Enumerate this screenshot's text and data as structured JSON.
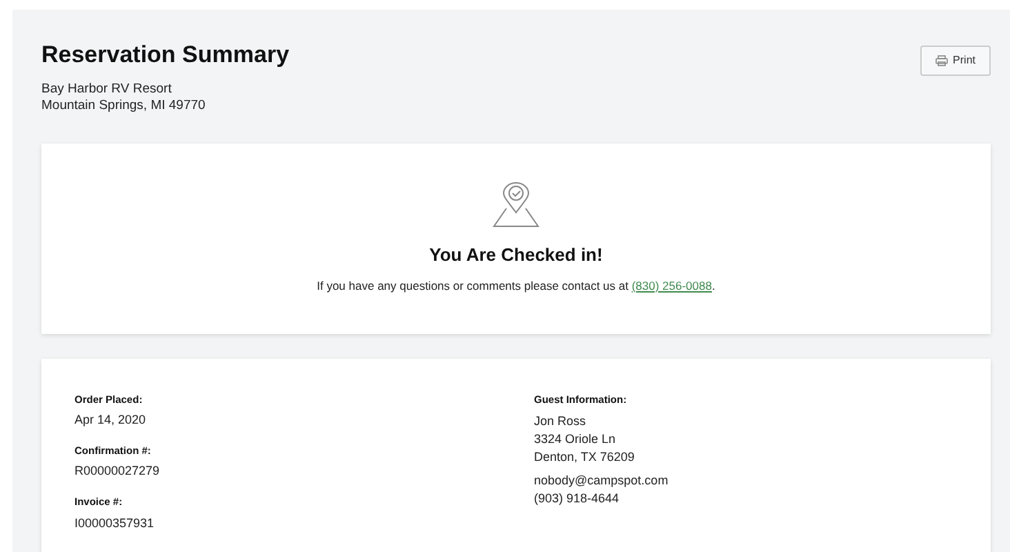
{
  "header": {
    "title": "Reservation Summary",
    "address_lines": [
      "Bay Harbor RV Resort",
      "Mountain Springs, MI 49770"
    ],
    "print_button": "Print"
  },
  "status": {
    "heading": "You Are Checked in!",
    "message_before": "If you have any questions or comments please contact us at ",
    "phone_link": "(830) 256-0088",
    "message_after": "."
  },
  "order": [
    {
      "label": "Order Placed:",
      "value": "Apr 14, 2020"
    },
    {
      "label": "Confirmation #:",
      "value": "R00000027279"
    },
    {
      "label": "Invoice #:",
      "value": "I00000357931"
    }
  ],
  "guest": {
    "label": "Guest Information:",
    "address": [
      "Jon Ross",
      "3324 Oriole Ln",
      "Denton, TX 76209"
    ],
    "contact": [
      "nobody@campspot.com",
      "(903) 918-4644"
    ]
  }
}
